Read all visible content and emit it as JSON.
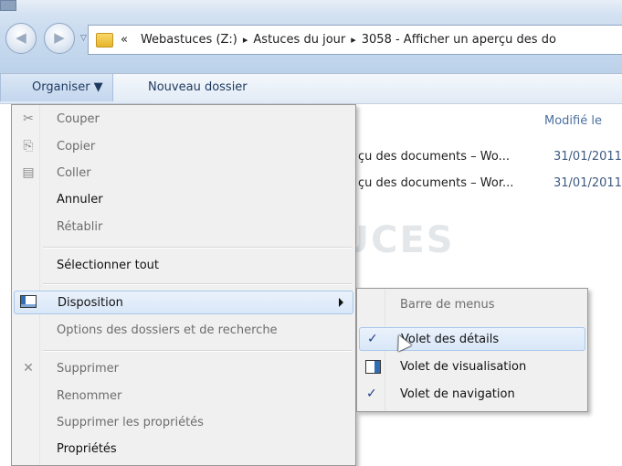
{
  "address_bar": {
    "overflow": "«",
    "crumbs": [
      "Webastuces (Z:)",
      "Astuces du jour",
      "3058 - Afficher un aperçu des do"
    ]
  },
  "toolbar": {
    "organise_label": "Organiser ▼",
    "new_folder_label": "Nouveau dossier"
  },
  "file_list": {
    "column_modified": "Modifié le",
    "rows": [
      {
        "name": "çu des documents – Wo...",
        "date": "31/01/2011"
      },
      {
        "name": "çu des documents – Wor...",
        "date": "31/01/2011"
      }
    ]
  },
  "watermark": "PC ASTUCES",
  "menu": {
    "cut": "Couper",
    "copy": "Copier",
    "paste": "Coller",
    "undo": "Annuler",
    "redo": "Rétablir",
    "select_all": "Sélectionner tout",
    "layout": "Disposition",
    "folder_options": "Options des dossiers et de recherche",
    "delete": "Supprimer",
    "rename": "Renommer",
    "remove_props": "Supprimer les propriétés",
    "properties": "Propriétés"
  },
  "submenu": {
    "menu_bar": "Barre de menus",
    "details_pane": "Volet des détails",
    "preview_pane": "Volet de visualisation",
    "navigation_pane": "Volet de navigation",
    "check_mark": "✓"
  }
}
